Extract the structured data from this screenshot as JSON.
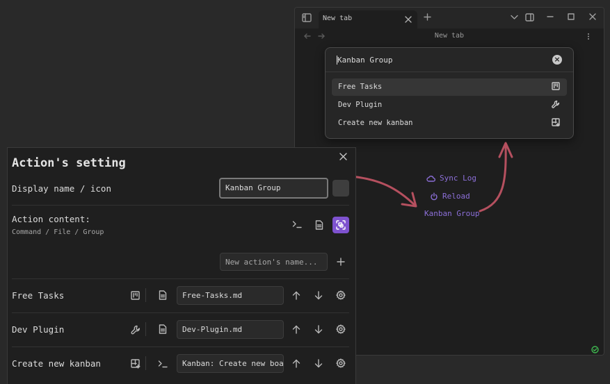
{
  "window": {
    "tab_label": "New tab",
    "nav_title": "New tab",
    "links": [
      {
        "label": "Sync Log",
        "icon": "cloud-icon"
      },
      {
        "label": "Reload",
        "icon": "power-icon"
      },
      {
        "label": "Kanban Group",
        "icon": ""
      }
    ]
  },
  "switcher": {
    "query": "Kanban Group",
    "items": [
      {
        "label": "Free Tasks",
        "icon": "kanban-icon",
        "selected": true
      },
      {
        "label": "Dev Plugin",
        "icon": "wrench-icon",
        "selected": false
      },
      {
        "label": "Create new kanban",
        "icon": "grid-plus-icon",
        "selected": false
      }
    ]
  },
  "modal": {
    "title": "Action's setting",
    "display_name_label": "Display name / icon",
    "display_name_value": "Kanban Group",
    "content_label": "Action content:",
    "content_desc": "Command / File / Group",
    "new_action_placeholder": "New action's name...",
    "actions": [
      {
        "label": "Free Tasks",
        "icon": "kanban-icon",
        "type_icon": "file-icon",
        "value": "Free-Tasks.md"
      },
      {
        "label": "Dev Plugin",
        "icon": "wrench-icon",
        "type_icon": "file-icon",
        "value": "Dev-Plugin.md"
      },
      {
        "label": "Create new kanban",
        "icon": "grid-plus-icon",
        "type_icon": "terminal-icon",
        "value": "Kanban: Create new boa"
      }
    ]
  },
  "colors": {
    "accent": "#7e52cf",
    "link": "#8c6fd8",
    "arrow": "#b5505f",
    "status_ok": "#3fb950"
  }
}
